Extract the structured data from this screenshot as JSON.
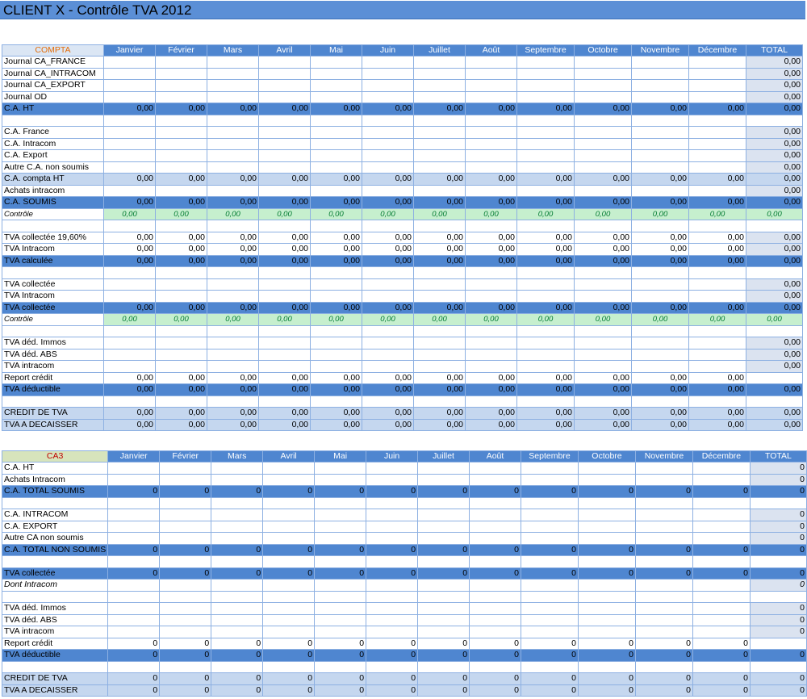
{
  "title": "CLIENT X - Contrôle TVA 2012",
  "months": [
    "Janvier",
    "Février",
    "Mars",
    "Avril",
    "Mai",
    "Juin",
    "Juillet",
    "Août",
    "Septembre",
    "Octobre",
    "Novembre",
    "Décembre"
  ],
  "total_label": "TOTAL",
  "colors": {
    "header_blue": "#4f86d0",
    "title_blue": "#5b8fd6",
    "light_blue": "#c5d7ef",
    "control_green": "#c6efce",
    "compta_orange": "#e36c09",
    "ca3_red": "#c00000"
  },
  "compta": {
    "corner": "COMPTA",
    "rows": [
      {
        "label": "Journal CA_FRANCE",
        "style": "norm",
        "months": null,
        "total": "0,00"
      },
      {
        "label": "Journal CA_INTRACOM",
        "style": "norm",
        "months": null,
        "total": "0,00"
      },
      {
        "label": "Journal CA_EXPORT",
        "style": "norm",
        "months": null,
        "total": "0,00"
      },
      {
        "label": "Journal OD",
        "style": "norm",
        "months": null,
        "total": "0,00"
      },
      {
        "label": "C.A. HT",
        "style": "hl",
        "months": "0,00",
        "total": "0,00"
      },
      {
        "label": "",
        "style": "blank",
        "months": null,
        "total": null
      },
      {
        "label": "C.A. France",
        "style": "norm",
        "months": null,
        "total": "0,00"
      },
      {
        "label": "C.A. Intracom",
        "style": "norm",
        "months": null,
        "total": "0,00"
      },
      {
        "label": "C.A. Export",
        "style": "norm",
        "months": null,
        "total": "0,00"
      },
      {
        "label": "Autre C.A. non soumis",
        "style": "norm",
        "months": null,
        "total": "0,00"
      },
      {
        "label": "C.A. compta HT",
        "style": "lt",
        "months": "0,00",
        "total": "0,00"
      },
      {
        "label": "Achats intracom",
        "style": "norm",
        "months": null,
        "total": "0,00"
      },
      {
        "label": "C.A. SOUMIS",
        "style": "hl",
        "months": "0,00",
        "total": "0,00"
      },
      {
        "label": "Contrôle",
        "style": "ctl",
        "months": "0,00",
        "total": "0,00"
      },
      {
        "label": "",
        "style": "blank",
        "months": null,
        "total": null
      },
      {
        "label": "TVA collectée 19,60%",
        "style": "norm",
        "months": "0,00",
        "total": "0,00"
      },
      {
        "label": "TVA Intracom",
        "style": "norm",
        "months": "0,00",
        "total": "0,00"
      },
      {
        "label": "TVA calculée",
        "style": "hl",
        "months": "0,00",
        "total": "0,00"
      },
      {
        "label": "",
        "style": "blank",
        "months": null,
        "total": null
      },
      {
        "label": "TVA collectée",
        "style": "norm",
        "months": null,
        "total": "0,00"
      },
      {
        "label": "TVA Intracom",
        "style": "norm",
        "months": null,
        "total": "0,00"
      },
      {
        "label": "TVA collectée",
        "style": "hl",
        "months": "0,00",
        "total": "0,00"
      },
      {
        "label": "Contrôle",
        "style": "ctl",
        "months": "0,00",
        "total": "0,00"
      },
      {
        "label": "",
        "style": "blank",
        "months": null,
        "total": null
      },
      {
        "label": "TVA déd. Immos",
        "style": "norm",
        "months": null,
        "total": "0,00"
      },
      {
        "label": "TVA déd. ABS",
        "style": "norm",
        "months": null,
        "total": "0,00"
      },
      {
        "label": "TVA intracom",
        "style": "norm",
        "months": null,
        "total": "0,00"
      },
      {
        "label": "Report crédit",
        "style": "norm",
        "months": "0,00",
        "total": ""
      },
      {
        "label": "TVA déductible",
        "style": "hl",
        "months": "0,00",
        "total": "0,00"
      },
      {
        "label": "",
        "style": "blank",
        "months": null,
        "total": null
      },
      {
        "label": "CREDIT DE TVA",
        "style": "lt",
        "months": "0,00",
        "total": "0,00"
      },
      {
        "label": "TVA A DECAISSER",
        "style": "lt",
        "months": "0,00",
        "total": "0,00"
      }
    ]
  },
  "ca3": {
    "corner": "CA3",
    "rows": [
      {
        "label": "C.A. HT",
        "style": "norm",
        "months": null,
        "total": "0"
      },
      {
        "label": "Achats Intracom",
        "style": "norm",
        "months": null,
        "total": "0"
      },
      {
        "label": "C.A. TOTAL SOUMIS",
        "style": "hl",
        "months": "0",
        "total": "0"
      },
      {
        "label": "",
        "style": "blank",
        "months": null,
        "total": null
      },
      {
        "label": "C.A. INTRACOM",
        "style": "norm",
        "months": null,
        "total": "0"
      },
      {
        "label": "C.A. EXPORT",
        "style": "norm",
        "months": null,
        "total": "0"
      },
      {
        "label": "Autre CA non soumis",
        "style": "norm",
        "months": null,
        "total": "0"
      },
      {
        "label": "C.A. TOTAL NON SOUMIS",
        "style": "hl",
        "months": "0",
        "total": "0"
      },
      {
        "label": "",
        "style": "blank",
        "months": null,
        "total": null
      },
      {
        "label": "TVA collectée",
        "style": "hl",
        "months": "0",
        "total": "0"
      },
      {
        "label": "Dont Intracom",
        "style": "norm it",
        "months": null,
        "total": "0"
      },
      {
        "label": "",
        "style": "blank",
        "months": null,
        "total": null
      },
      {
        "label": "TVA déd. Immos",
        "style": "norm",
        "months": null,
        "total": "0"
      },
      {
        "label": "TVA déd. ABS",
        "style": "norm",
        "months": null,
        "total": "0"
      },
      {
        "label": "TVA intracom",
        "style": "norm",
        "months": null,
        "total": "0"
      },
      {
        "label": "Report crédit",
        "style": "norm",
        "months": "0",
        "total": ""
      },
      {
        "label": "TVA déductible",
        "style": "hl",
        "months": "0",
        "total": "0"
      },
      {
        "label": "",
        "style": "blank",
        "months": null,
        "total": null
      },
      {
        "label": "CREDIT DE TVA",
        "style": "lt",
        "months": "0",
        "total": "0"
      },
      {
        "label": "TVA A DECAISSER",
        "style": "lt",
        "months": "0",
        "total": "0"
      }
    ]
  }
}
